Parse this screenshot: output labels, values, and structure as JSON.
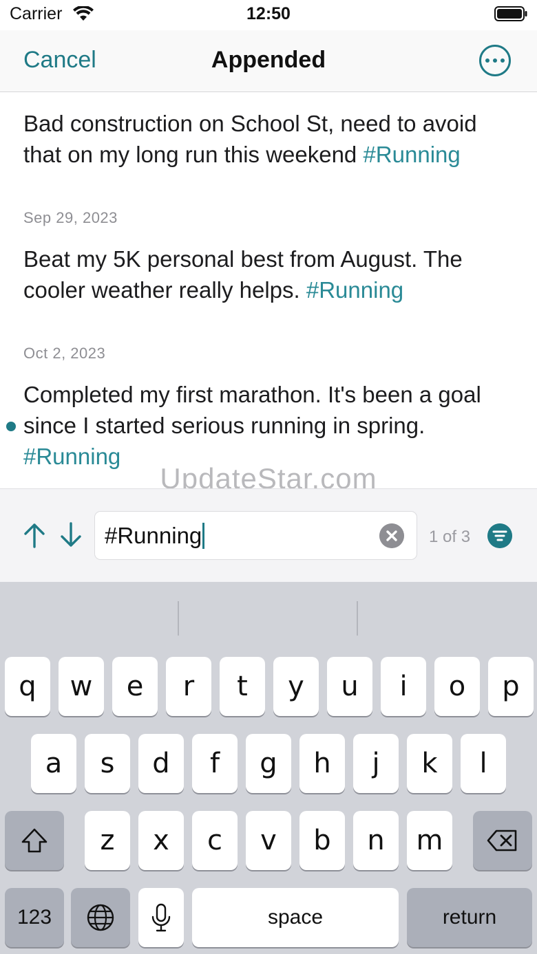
{
  "status_bar": {
    "carrier": "Carrier",
    "time": "12:50"
  },
  "nav": {
    "cancel_label": "Cancel",
    "title": "Appended",
    "more_icon": "ellipsis-circle-icon"
  },
  "entries": [
    {
      "date": "",
      "text": "Bad construction on School St, need to avoid that on my long run this weekend ",
      "tag": "#Running",
      "current": false
    },
    {
      "date": "Sep 29, 2023",
      "text": "Beat my 5K personal best from August. The cooler weather really helps. ",
      "tag": "#Running",
      "current": false
    },
    {
      "date": "Oct 2, 2023",
      "text": "Completed my first marathon. It's been a goal since I started serious running in spring. ",
      "tag": "#Running",
      "current": true
    }
  ],
  "watermark": "UpdateStar.com",
  "search": {
    "value": "#Running",
    "match_count": "1 of 3",
    "up_icon": "arrow-up-icon",
    "down_icon": "arrow-down-icon",
    "clear_icon": "clear-circle-icon",
    "filter_icon": "filter-circle-icon"
  },
  "keyboard": {
    "row1": [
      "q",
      "w",
      "e",
      "r",
      "t",
      "y",
      "u",
      "i",
      "o",
      "p"
    ],
    "row2": [
      "a",
      "s",
      "d",
      "f",
      "g",
      "h",
      "j",
      "k",
      "l"
    ],
    "row3": [
      "z",
      "x",
      "c",
      "v",
      "b",
      "n",
      "m"
    ],
    "numbers_label": "123",
    "space_label": "space",
    "return_label": "return"
  },
  "colors": {
    "accent": "#1f7a86",
    "tag": "#2a8a96",
    "keyboard_bg": "#d1d3d9"
  }
}
